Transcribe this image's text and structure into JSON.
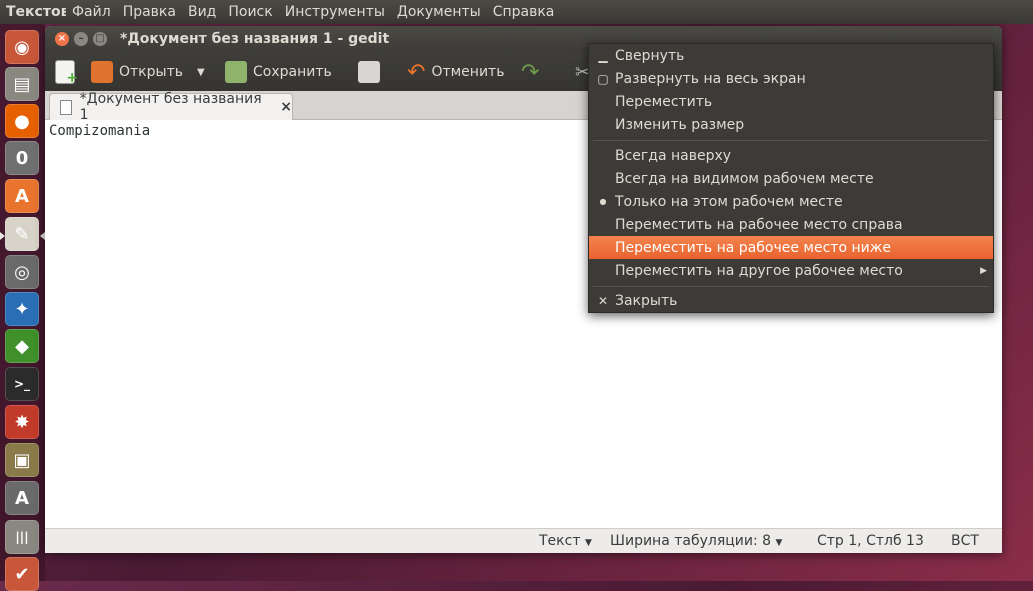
{
  "top_panel": {
    "app_name": "Текстов",
    "menu": [
      "Файл",
      "Правка",
      "Вид",
      "Поиск",
      "Инструменты",
      "Документы",
      "Справка"
    ]
  },
  "launcher": {
    "items": [
      {
        "name": "ubuntu-dash-icon",
        "glyph": "◉",
        "color": "#c8573a"
      },
      {
        "name": "files-icon",
        "glyph": "▤",
        "color": "#8a8680"
      },
      {
        "name": "firefox-icon",
        "glyph": "●",
        "color": "#e66000"
      },
      {
        "name": "message-icon",
        "glyph": "0",
        "color": "#6f6f6f"
      },
      {
        "name": "software-center-icon",
        "glyph": "A",
        "color": "#e8742e"
      },
      {
        "name": "text-editor-icon",
        "glyph": "✎",
        "color": "#d7d3c9"
      },
      {
        "name": "camera-icon",
        "glyph": "◎",
        "color": "#6a6a6a"
      },
      {
        "name": "blue-app-icon",
        "glyph": "✦",
        "color": "#2a6fb5"
      },
      {
        "name": "green-app-icon",
        "glyph": "◆",
        "color": "#3f8f2a"
      },
      {
        "name": "terminal-icon",
        "glyph": ">_",
        "color": "#2b2b2b"
      },
      {
        "name": "settings-icon",
        "glyph": "✸",
        "color": "#c23a2a"
      },
      {
        "name": "archive-icon",
        "glyph": "▣",
        "color": "#8a7a4a"
      },
      {
        "name": "update-icon",
        "glyph": "A",
        "color": "#6a6a6a"
      },
      {
        "name": "mixer-icon",
        "glyph": "|||",
        "color": "#8a8680"
      },
      {
        "name": "check-icon",
        "glyph": "✔",
        "color": "#c8573a"
      }
    ]
  },
  "window": {
    "title": "*Документ без названия 1 - gedit",
    "toolbar": {
      "open_label": "Открыть",
      "save_label": "Сохранить",
      "undo_label": "Отменить"
    },
    "tab_label": "*Документ без названия 1",
    "editor_text": "Compizomania",
    "statusbar": {
      "language": "Текст",
      "tab_width": "Ширина табуляции: 8",
      "position": "Стр 1, Стлб 13",
      "mode": "ВСТ"
    }
  },
  "context_menu": {
    "items": [
      {
        "label": "Свернуть",
        "mark": "▁"
      },
      {
        "label": "Развернуть на весь экран",
        "mark": "▢"
      },
      {
        "label": "Переместить",
        "mark": ""
      },
      {
        "label": "Изменить размер",
        "mark": ""
      },
      {
        "label": "Всегда наверху",
        "mark": ""
      },
      {
        "label": "Всегда на видимом рабочем месте",
        "mark": ""
      },
      {
        "label": "Только на этом рабочем месте",
        "mark": "●"
      },
      {
        "label": "Переместить на рабочее место справа",
        "mark": ""
      },
      {
        "label": "Переместить на рабочее место ниже",
        "mark": ""
      },
      {
        "label": "Переместить на другое рабочее место",
        "mark": ""
      },
      {
        "label": "Закрыть",
        "mark": "✕"
      }
    ],
    "highlighted_index": 8,
    "highlight_color": "#e9632e"
  }
}
